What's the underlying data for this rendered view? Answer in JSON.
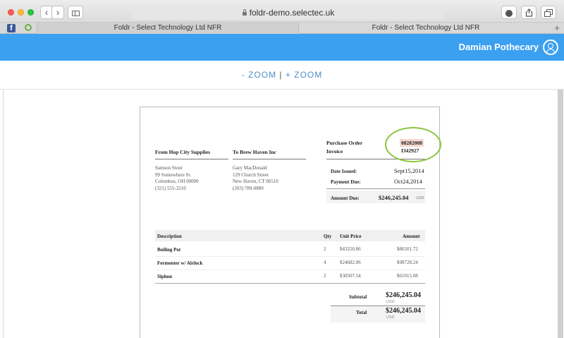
{
  "browser": {
    "url": "foldr-demo.selectec.uk",
    "nav_back": "‹",
    "nav_forward": "›",
    "tabs": [
      {
        "label": "Foldr - Select Technology Ltd NFR"
      },
      {
        "label": "Foldr - Select Technology Ltd NFR"
      }
    ],
    "new_tab": "+",
    "facebook_glyph": "f"
  },
  "app": {
    "user_name": "Damian Pothecary"
  },
  "zoom": {
    "zoom_out": "- ZOOM",
    "separator": "|",
    "zoom_in": "+ ZOOM"
  },
  "invoice": {
    "from_heading": "From Hop City Supplies",
    "to_heading": "To Brew Haven Inc",
    "from_address": [
      "Samson Stout",
      "99 Somewhere St.",
      "Columbus, OH 00000",
      "(321) 555-3210"
    ],
    "to_address": [
      "Gary MacDonald",
      "129 Church Street",
      "New Haven, CT 06510",
      "(203) 789-0889"
    ],
    "po_label": "Purchase Order",
    "invoice_label": "Invoice",
    "po_number": "08282008",
    "invoice_number": "I342927",
    "date_issued_label": "Date Issued:",
    "date_issued": "Sept15,2014",
    "payment_due_label": "Payment Due:",
    "payment_due": "Oct24,2014",
    "amount_due_label": "Amount Due:",
    "amount_due": "$246,245.04",
    "currency": "USD",
    "columns": {
      "description": "Description",
      "qty": "Qty",
      "unit_price": "Unit Price",
      "amount": "Amount"
    },
    "items": [
      {
        "description": "Boiling Pot",
        "qty": "2",
        "unit_price": "$43250.86",
        "amount": "$86501.72"
      },
      {
        "description": "Fermenter w/ Airlock",
        "qty": "4",
        "unit_price": "$24682.06",
        "amount": "$98728.24"
      },
      {
        "description": "Siphon",
        "qty": "2",
        "unit_price": "$30507.54",
        "amount": "$61015.08"
      }
    ],
    "subtotal_label": "Subtotal",
    "subtotal": "$246,245.04",
    "total_label": "Total",
    "total": "$246,245.04"
  }
}
